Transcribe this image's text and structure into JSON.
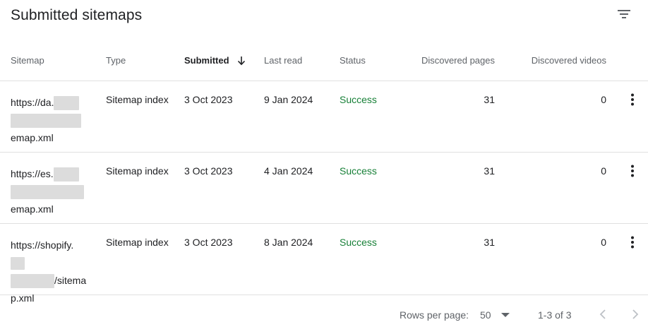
{
  "header": {
    "title": "Submitted sitemaps",
    "filter_icon": "filter-list-icon"
  },
  "table": {
    "columns": {
      "sitemap": "Sitemap",
      "type": "Type",
      "submitted": "Submitted",
      "last_read": "Last read",
      "status": "Status",
      "discovered_pages": "Discovered pages",
      "discovered_videos": "Discovered videos"
    },
    "sort_icon": "arrow-downward-icon",
    "rows": [
      {
        "sitemap_start": "https://da.",
        "sitemap_end": "emap.xml",
        "type": "Sitemap index",
        "submitted": "3 Oct 2023",
        "last_read": "9 Jan 2024",
        "status": "Success",
        "discovered_pages": "31",
        "discovered_videos": "0"
      },
      {
        "sitemap_start": "https://es.",
        "sitemap_end": "emap.xml",
        "type": "Sitemap index",
        "submitted": "3 Oct 2023",
        "last_read": "4 Jan 2024",
        "status": "Success",
        "discovered_pages": "31",
        "discovered_videos": "0"
      },
      {
        "sitemap_start": "https://shopify.",
        "sitemap_mid": "/sitema",
        "sitemap_end": "p.xml",
        "type": "Sitemap index",
        "submitted": "3 Oct 2023",
        "last_read": "8 Jan 2024",
        "status": "Success",
        "discovered_pages": "31",
        "discovered_videos": "0"
      }
    ],
    "more_icon": "more-vert-icon"
  },
  "footer": {
    "rows_per_page_label": "Rows per page:",
    "rows_per_page_value": "50",
    "range": "1-3 of 3",
    "prev_icon": "chevron-left-icon",
    "next_icon": "chevron-right-icon"
  },
  "colors": {
    "status_success": "#188038",
    "text_primary": "#202124",
    "text_secondary": "#5f6368",
    "divider": "#e0e0e0",
    "redaction": "#dcdcdc"
  }
}
